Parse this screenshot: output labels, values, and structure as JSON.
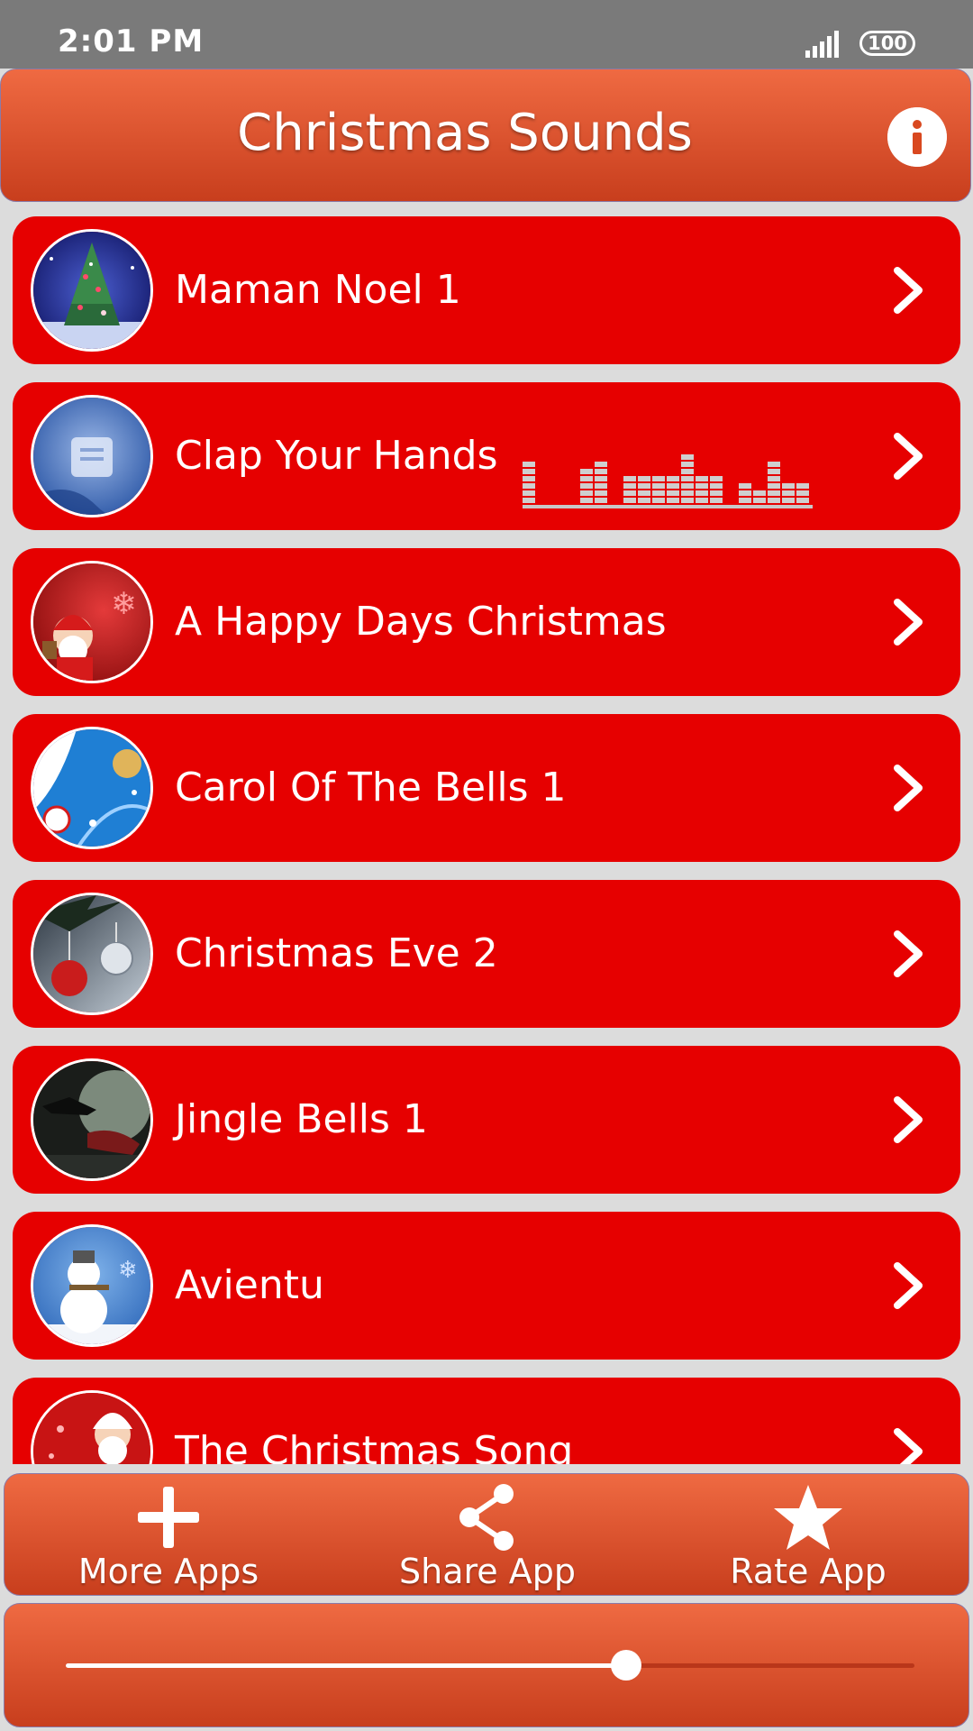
{
  "status_bar": {
    "time": "2:01 PM",
    "battery": "100"
  },
  "header": {
    "title": "Christmas Sounds",
    "info_icon": "info-icon"
  },
  "colors": {
    "header_top": "#ef6a42",
    "header_bottom": "#c83e1d",
    "item_bg": "#e60000",
    "page_bg": "#dcdcdc"
  },
  "list": {
    "items": [
      {
        "label": "Maman Noel 1",
        "thumb": "christmas-tree"
      },
      {
        "label": "Clap Your Hands",
        "thumb": "snow-ornament",
        "playing": true
      },
      {
        "label": "A Happy Days Christmas",
        "thumb": "santa"
      },
      {
        "label": "Carol Of The Bells 1",
        "thumb": "blue-baubles"
      },
      {
        "label": "Christmas Eve 2",
        "thumb": "ornaments-dark"
      },
      {
        "label": "Jingle Bells 1",
        "thumb": "sleigh-moon"
      },
      {
        "label": "Avientu",
        "thumb": "snowman"
      },
      {
        "label": "The Christmas Song",
        "thumb": "santa-red"
      }
    ]
  },
  "bottom_nav": {
    "more_apps": "More Apps",
    "share_app": "Share App",
    "rate_app": "Rate App"
  },
  "player": {
    "progress": 0.66
  }
}
